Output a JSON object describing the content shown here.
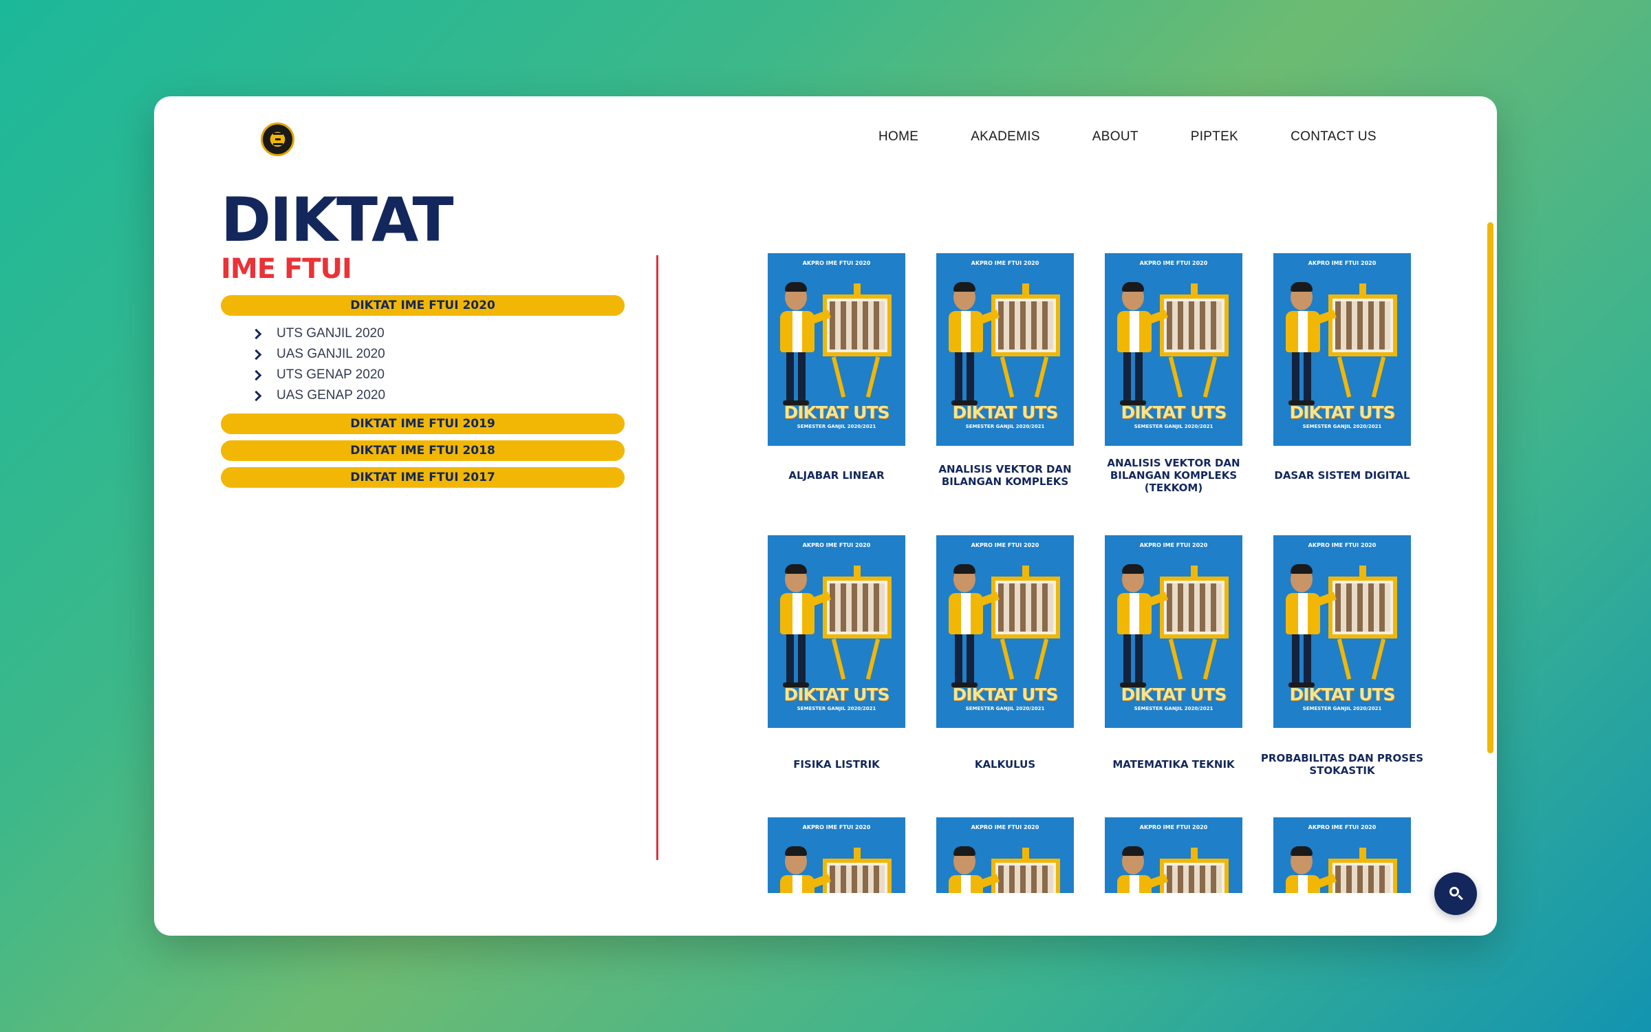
{
  "nav": {
    "items": [
      "HOME",
      "AKADEMIS",
      "ABOUT",
      "PIPTEK",
      "CONTACT US"
    ]
  },
  "page": {
    "title": "DIKTAT",
    "subtitle": "IME FTUI"
  },
  "sidebar": {
    "sections": [
      {
        "label": "DIKTAT IME FTUI 2020",
        "expanded": true
      },
      {
        "label": "DIKTAT IME FTUI 2019",
        "expanded": false
      },
      {
        "label": "DIKTAT IME FTUI 2018",
        "expanded": false
      },
      {
        "label": "DIKTAT IME FTUI 2017",
        "expanded": false
      }
    ],
    "sub_items": [
      "UTS GANJIL 2020",
      "UAS GANJIL 2020",
      "UTS GENAP 2020",
      "UAS GENAP 2020"
    ]
  },
  "cover": {
    "header": "AKPRO IME FTUI 2020",
    "title": "DIKTAT UTS",
    "subtitle": "SEMESTER GANJIL 2020/2021"
  },
  "books": [
    {
      "title": "ALJABAR LINEAR"
    },
    {
      "title": "ANALISIS VEKTOR DAN BILANGAN KOMPLEKS"
    },
    {
      "title": "ANALISIS VEKTOR DAN BILANGAN KOMPLEKS (TEKKOM)"
    },
    {
      "title": "DASAR SISTEM DIGITAL"
    },
    {
      "title": "FISIKA LISTRIK"
    },
    {
      "title": "KALKULUS"
    },
    {
      "title": "MATEMATIKA TEKNIK"
    },
    {
      "title": "PROBABILITAS DAN PROSES STOKASTIK"
    }
  ],
  "colors": {
    "navy": "#13275c",
    "accent_red": "#ea3237",
    "accent_yellow": "#f2b705",
    "cover_blue": "#1f7fc9"
  },
  "icons": {
    "search": "search-icon",
    "chevron": "chevron-right-icon",
    "logo": "ime-ftui-logo"
  }
}
